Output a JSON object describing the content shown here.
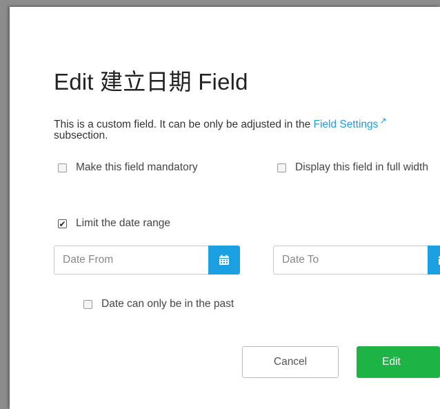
{
  "dialog": {
    "title": "Edit 建立日期 Field",
    "description": {
      "before": "This is a custom field. It can be only be adjusted in the ",
      "link": "Field Settings",
      "after": " subsection."
    },
    "options": {
      "mandatory": {
        "label": "Make this field mandatory",
        "checked": false
      },
      "full_width": {
        "label": "Display this field in full width",
        "checked": false
      },
      "limit_range": {
        "label": "Limit the date range",
        "checked": true
      },
      "past_only": {
        "label": "Date can only be in the past",
        "checked": false
      }
    },
    "date_from": {
      "placeholder": "Date From",
      "value": ""
    },
    "date_to": {
      "placeholder": "Date To",
      "value": ""
    },
    "buttons": {
      "cancel": "Cancel",
      "edit": "Edit"
    }
  },
  "colors": {
    "link": "#1f9be0",
    "calendar_button": "#1ba1e2",
    "edit_button": "#1eb345"
  },
  "icons": {
    "external_link": "external-link-icon",
    "calendar": "calendar-icon",
    "checkmark": "checkmark-icon"
  }
}
